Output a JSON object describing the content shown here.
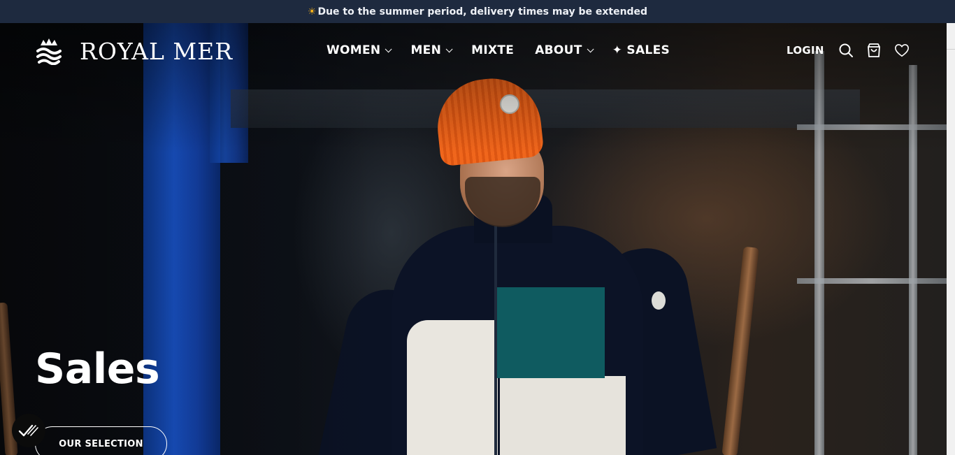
{
  "announcement": {
    "icon": "sun-icon",
    "text": "Due to the summer period, delivery times may be extended"
  },
  "header": {
    "logo_text": "ROYAL MER",
    "logo_icon": "crown-wave-icon",
    "nav": [
      {
        "label": "WOMEN",
        "has_dropdown": true
      },
      {
        "label": "MEN",
        "has_dropdown": true
      },
      {
        "label": "MIXTE",
        "has_dropdown": false
      },
      {
        "label": "ABOUT",
        "has_dropdown": true
      },
      {
        "label": "✦ SALES",
        "has_dropdown": false
      }
    ],
    "login_label": "LOGIN",
    "icons": [
      "search-icon",
      "cart-icon",
      "heart-icon"
    ]
  },
  "hero": {
    "title": "Sales",
    "cta_label": "OUR SELECTION",
    "badge_icon": "verified-check-icon"
  },
  "colors": {
    "announcement_bg": "#1e2a3f",
    "sun": "#f6b21b",
    "beanie": "#f0661c",
    "teal": "#0f5b60"
  }
}
